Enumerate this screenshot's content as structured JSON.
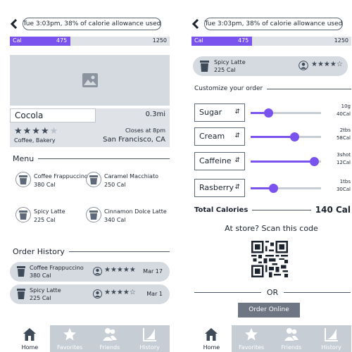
{
  "status_text": "Tue 3:03pm,  38% of calorie allowance used",
  "calorie_bar": {
    "tag": "Cal",
    "current": "475",
    "max": "1250",
    "progress": 0.38,
    "accent": "#7a52ee"
  },
  "shop": {
    "name": "Cocola",
    "distance": "0.3mi",
    "rating": 4,
    "rating_max": 5,
    "category": "Coffee, Bakery",
    "hours": "Closes at 8pm",
    "location": "San Francisco, CA"
  },
  "menu": {
    "heading": "Menu",
    "items": [
      {
        "name": "Coffee Frappuccino",
        "cal": "380 Cal"
      },
      {
        "name": "Caramel Macchiato",
        "cal": "250 Cal"
      },
      {
        "name": "Spicy Latte",
        "cal": "225 Cal"
      },
      {
        "name": "Cinnamon Dolce Latte",
        "cal": "340 Cal"
      }
    ]
  },
  "order_history": {
    "heading": "Order History",
    "orders": [
      {
        "name": "Coffee Frappuccino",
        "cal": "380 Cal",
        "stars": "★★★★★",
        "date": "Mar 17"
      },
      {
        "name": "Spicy Latte",
        "cal": "225 Cal",
        "stars": "★★★★☆",
        "date": "Mar 1"
      }
    ]
  },
  "nav": [
    {
      "label": "Home",
      "icon": "home-icon",
      "active": true
    },
    {
      "label": "Favorites",
      "icon": "star-icon",
      "active": false
    },
    {
      "label": "Friends",
      "icon": "friends-icon",
      "active": false
    },
    {
      "label": "History",
      "icon": "history-icon",
      "active": false
    }
  ],
  "customize": {
    "selected_item": {
      "name": "Spicy Latte",
      "cal": "225 Cal",
      "stars": "★★★★☆"
    },
    "heading": "Customize your order",
    "options": [
      {
        "label": "Sugar",
        "amount": "10g",
        "cal": "40Cal",
        "level": 0.25
      },
      {
        "label": "Cream",
        "amount": "2tbs",
        "cal": "58Cal",
        "level": 0.62
      },
      {
        "label": "Caffeine",
        "amount": "3shot",
        "cal": "12Cal",
        "level": 0.9
      },
      {
        "label": "Rasberry",
        "amount": "1tbs",
        "cal": "30Cal",
        "level": 0.32
      }
    ],
    "total_label": "Total Calories",
    "total_value": "140 Cal",
    "scan_text": "At store? Scan this code",
    "or_text": "OR",
    "order_button": "Order Online"
  }
}
